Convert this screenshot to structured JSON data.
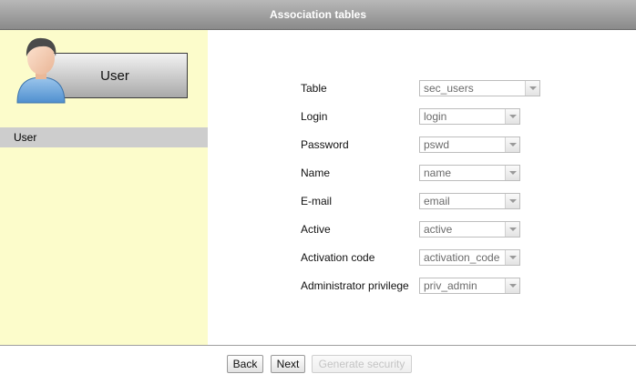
{
  "header": {
    "title": "Association tables"
  },
  "sidebar": {
    "avatar_icon": "user-avatar-icon",
    "user_box_label": "User",
    "items": [
      {
        "label": "User",
        "selected": true
      }
    ]
  },
  "form": {
    "fields": [
      {
        "label": "Table",
        "value": "sec_users"
      },
      {
        "label": "Login",
        "value": "login"
      },
      {
        "label": "Password",
        "value": "pswd"
      },
      {
        "label": "Name",
        "value": "name"
      },
      {
        "label": "E-mail",
        "value": "email"
      },
      {
        "label": "Active",
        "value": "active"
      },
      {
        "label": "Activation code",
        "value": "activation_code"
      },
      {
        "label": "Administrator privilege",
        "value": "priv_admin"
      }
    ]
  },
  "footer": {
    "back_label": "Back",
    "next_label": "Next",
    "generate_label": "Generate security"
  }
}
